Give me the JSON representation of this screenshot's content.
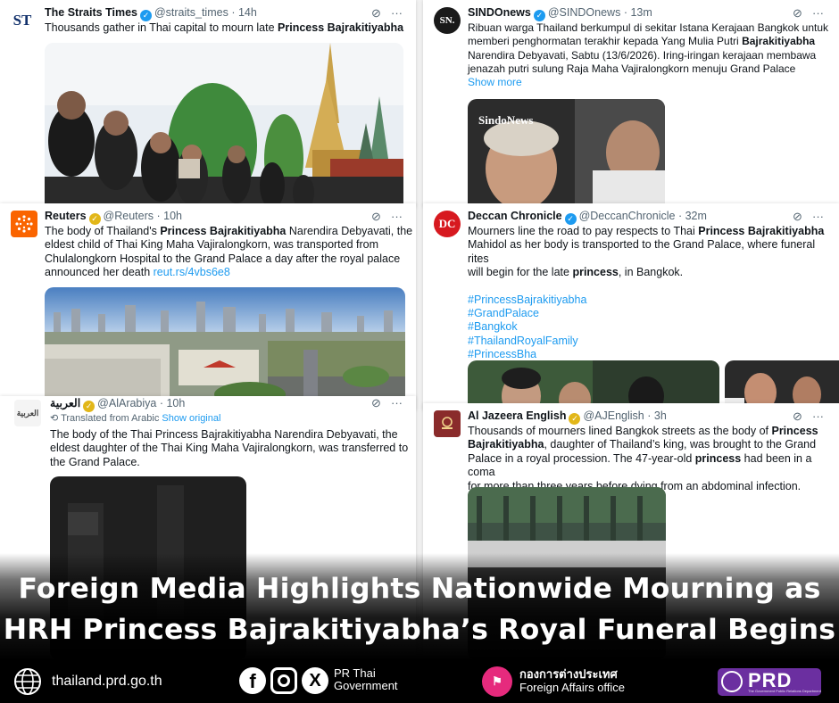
{
  "tweets": {
    "straits": {
      "name": "The Straits Times",
      "handle": "@straits_times",
      "time": "· 14h",
      "avatar_text": "ST",
      "text_parts": [
        "Thousands gather in Thai capital to mourn late ",
        "Princess Bajrakitiyabha"
      ]
    },
    "sindo": {
      "name": "SINDOnews",
      "handle": "@SINDOnews",
      "time": "· 13m",
      "avatar_text": "SN.",
      "line1": "Ribuan warga Thailand berkumpul di sekitar Istana Kerajaan Bangkok untuk",
      "line2a": "memberi penghormatan terakhir kepada Yang Mulia Putri ",
      "line2b": "Bajrakitiyabha",
      "line3": "Narendira Debyavati, Sabtu (13/6/2026). Iring-iringan kerajaan membawa",
      "line4": "jenazah putri sulung Raja Maha Vajiralongkorn menuju Grand Palace",
      "show_more": "Show more",
      "image_watermark": "SindoNews"
    },
    "reuters": {
      "name": "Reuters",
      "handle": "@Reuters",
      "time": "· 10h",
      "line1a": "The body of Thailand's ",
      "line1b": "Princess Bajrakitiyabha",
      "line1c": " Narendira Debyavati, the",
      "line2": "eldest child of Thai King Maha Vajiralongkorn, was transported from",
      "line3": "Chulalongkorn Hospital to the Grand Palace a day after the royal palace",
      "line4": "announced her death ",
      "link": "reut.rs/4vbs6e8"
    },
    "deccan": {
      "name": "Deccan Chronicle",
      "handle": "@DeccanChronicle",
      "time": "· 32m",
      "avatar_text": "DC",
      "line1a": "Mourners line the road to pay respects to Thai ",
      "line1b": "Princess Bajrakitiyabha",
      "line2": "Mahidol as her body is transported to the Grand Palace, where funeral rites",
      "line3a": "will begin for the late ",
      "line3b": "princess",
      "line3c": ", in Bangkok.",
      "hashtags": [
        "#PrincessBajrakitiyabha",
        "#GrandPalace",
        "#Bangkok",
        "#ThailandRoyalFamily",
        "#PrincessBha"
      ]
    },
    "arabiya": {
      "name": "العربية",
      "handle": "@AlArabiya",
      "time": "· 10h",
      "avatar_text": "العربية",
      "translated": "Translated from Arabic",
      "show_original": "Show original",
      "line1": "The body of the Thai Princess Bajrakitiyabha Narendira Debyavati, the",
      "line2": "eldest daughter of the Thai King Maha Vajiralongkorn, was transferred to",
      "line3": "the Grand Palace."
    },
    "aljazeera": {
      "name": "Al Jazeera English",
      "handle": "@AJEnglish",
      "time": "· 3h",
      "line1a": "Thousands of mourners lined Bangkok streets as the body of ",
      "line1b": "Princess",
      "line2a": "Bajrakitiyabha",
      "line2b": ", daughter of Thailand’s king, was brought to the Grand",
      "line3": "Palace in a royal procession. The 47-year-old ",
      "line3b": "princess",
      "line3c": " had been in a coma",
      "line4": "for more than three years before dying from an abdominal infection."
    }
  },
  "headline": {
    "line1": "Foreign Media Highlights Nationwide Mourning as",
    "line2": "HRH Princess Bajrakitiyabha’s Royal Funeral Begins"
  },
  "footer": {
    "website": "thailand.prd.go.th",
    "pr_line1": "PR Thai",
    "pr_line2": "Government",
    "office_thai": "กองการต่างประเทศ",
    "office_en": "Foreign Affairs office",
    "logo_text": "PRD",
    "logo_sub": "The Government Public Relations Department"
  },
  "colors": {
    "verified": "#1d9bf0",
    "gold_verified": "#e2b719",
    "link": "#1d9bf0",
    "prd_purple": "#6b2fa0"
  }
}
